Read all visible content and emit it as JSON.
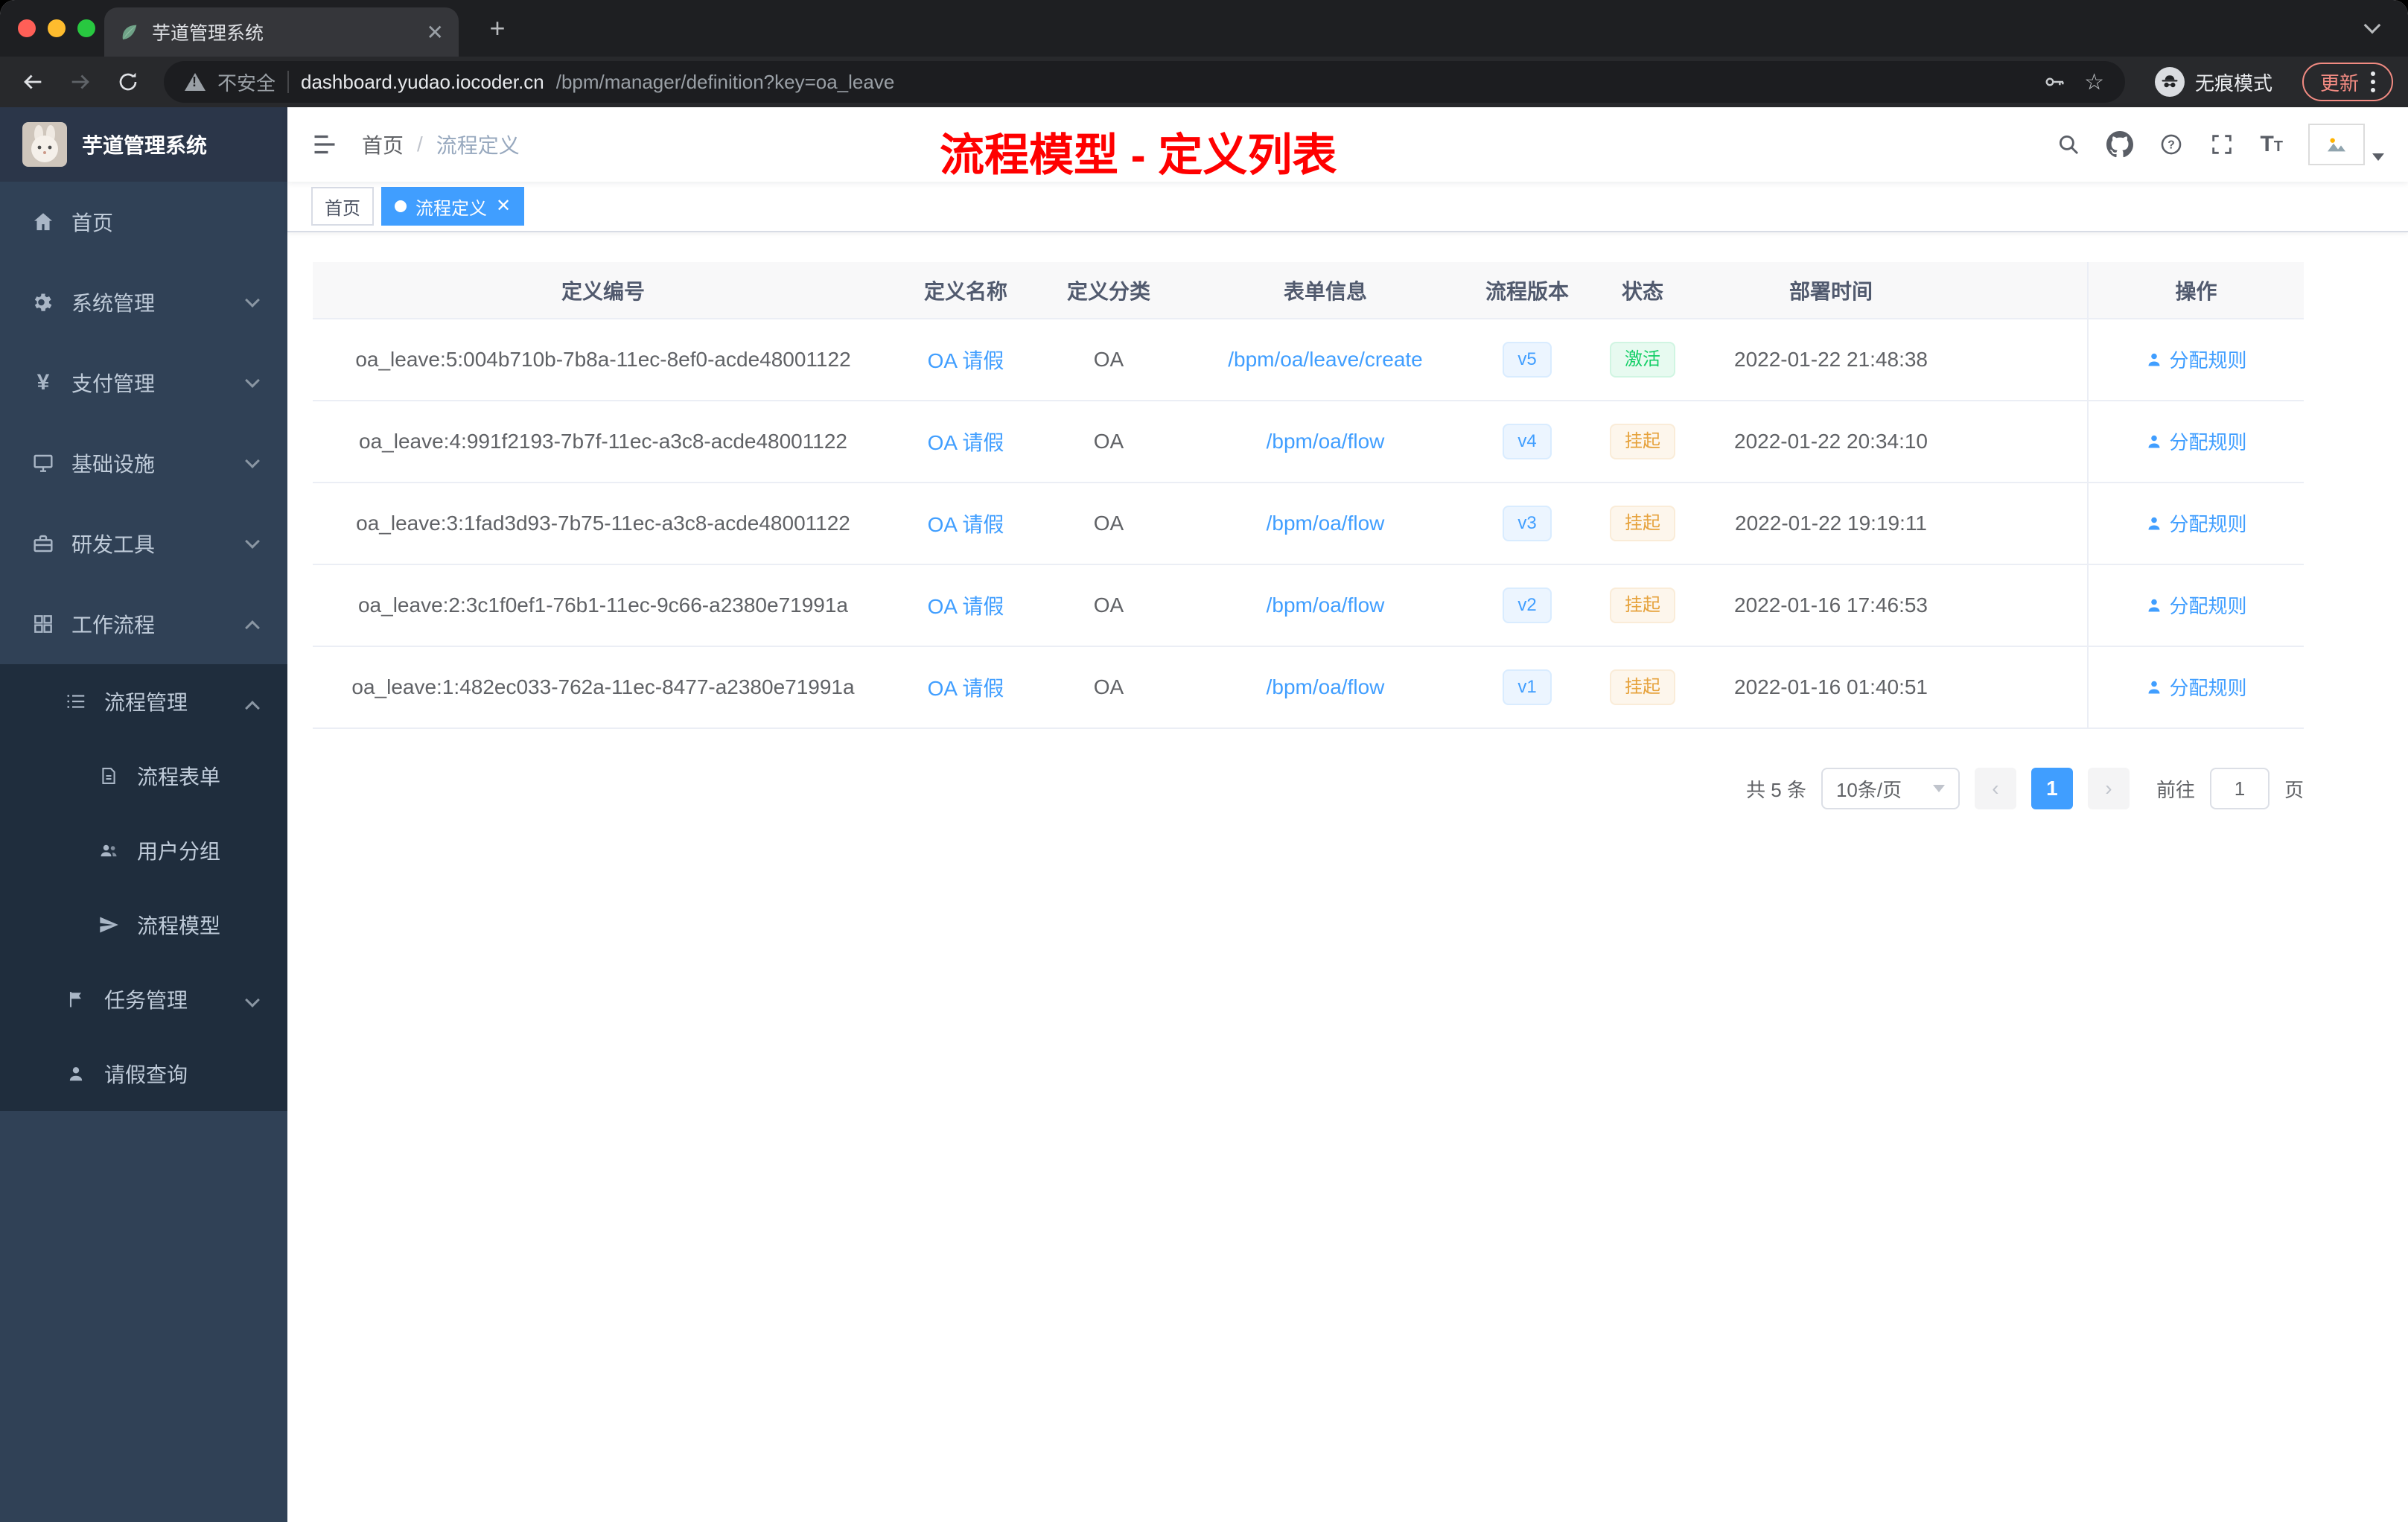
{
  "browser": {
    "tab_title": "芋道管理系统",
    "security_label": "不安全",
    "url_domain": "dashboard.yudao.iocoder.cn",
    "url_path": "/bpm/manager/definition?key=oa_leave",
    "incognito_label": "无痕模式",
    "update_label": "更新"
  },
  "sidebar": {
    "app_title": "芋道管理系统",
    "items": [
      {
        "label": "首页"
      },
      {
        "label": "系统管理"
      },
      {
        "label": "支付管理"
      },
      {
        "label": "基础设施"
      },
      {
        "label": "研发工具"
      },
      {
        "label": "工作流程"
      },
      {
        "label": "流程管理"
      },
      {
        "label": "流程表单"
      },
      {
        "label": "用户分组"
      },
      {
        "label": "流程模型"
      },
      {
        "label": "任务管理"
      },
      {
        "label": "请假查询"
      }
    ]
  },
  "header": {
    "breadcrumb_home": "首页",
    "breadcrumb_current": "流程定义",
    "annotation": "流程模型 - 定义列表"
  },
  "tags": {
    "home": "首页",
    "active": "流程定义"
  },
  "table": {
    "columns": [
      "定义编号",
      "定义名称",
      "定义分类",
      "表单信息",
      "流程版本",
      "状态",
      "部署时间",
      "操作"
    ],
    "rows": [
      {
        "id": "oa_leave:5:004b710b-7b8a-11ec-8ef0-acde48001122",
        "name": "OA 请假",
        "category": "OA",
        "form": "/bpm/oa/leave/create",
        "version": "v5",
        "status": "激活",
        "deploy_time": "2022-01-22 21:48:38",
        "action": "分配规则"
      },
      {
        "id": "oa_leave:4:991f2193-7b7f-11ec-a3c8-acde48001122",
        "name": "OA 请假",
        "category": "OA",
        "form": "/bpm/oa/flow",
        "version": "v4",
        "status": "挂起",
        "deploy_time": "2022-01-22 20:34:10",
        "action": "分配规则"
      },
      {
        "id": "oa_leave:3:1fad3d93-7b75-11ec-a3c8-acde48001122",
        "name": "OA 请假",
        "category": "OA",
        "form": "/bpm/oa/flow",
        "version": "v3",
        "status": "挂起",
        "deploy_time": "2022-01-22 19:19:11",
        "action": "分配规则"
      },
      {
        "id": "oa_leave:2:3c1f0ef1-76b1-11ec-9c66-a2380e71991a",
        "name": "OA 请假",
        "category": "OA",
        "form": "/bpm/oa/flow",
        "version": "v2",
        "status": "挂起",
        "deploy_time": "2022-01-16 17:46:53",
        "action": "分配规则"
      },
      {
        "id": "oa_leave:1:482ec033-762a-11ec-8477-a2380e71991a",
        "name": "OA 请假",
        "category": "OA",
        "form": "/bpm/oa/flow",
        "version": "v1",
        "status": "挂起",
        "deploy_time": "2022-01-16 01:40:51",
        "action": "分配规则"
      }
    ]
  },
  "pagination": {
    "total": "共 5 条",
    "page_size": "10条/页",
    "current_page": "1",
    "goto_label": "前往",
    "goto_value": "1",
    "page_unit": "页"
  }
}
